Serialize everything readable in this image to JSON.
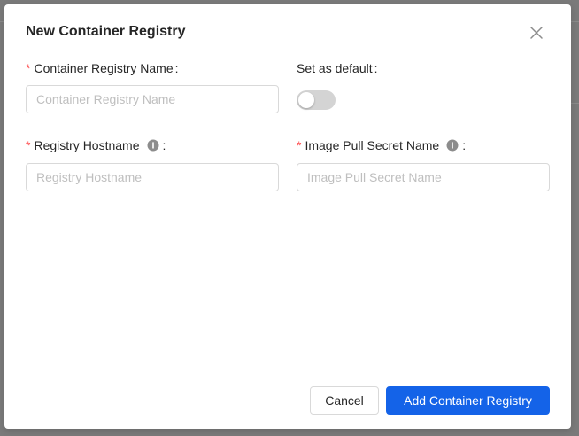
{
  "modal": {
    "title": "New Container Registry"
  },
  "form": {
    "registry_name": {
      "label": "Container Registry Name",
      "colon": ":",
      "placeholder": "Container Registry Name",
      "value": ""
    },
    "set_default": {
      "label": "Set as default",
      "colon": ":",
      "enabled": false
    },
    "hostname": {
      "label": "Registry Hostname",
      "colon": ":",
      "placeholder": "Registry Hostname",
      "value": ""
    },
    "pull_secret": {
      "label": "Image Pull Secret Name",
      "colon": ":",
      "placeholder": "Image Pull Secret Name",
      "value": ""
    },
    "required_marker": "*"
  },
  "footer": {
    "cancel_label": "Cancel",
    "submit_label": "Add Container Registry"
  },
  "icons": {
    "close": "close-icon",
    "info": "info-icon"
  },
  "colors": {
    "primary": "#1463e8",
    "required": "#ff4d4f",
    "switch_off": "#d4d4d4",
    "overlay": "#7a7a7a"
  }
}
